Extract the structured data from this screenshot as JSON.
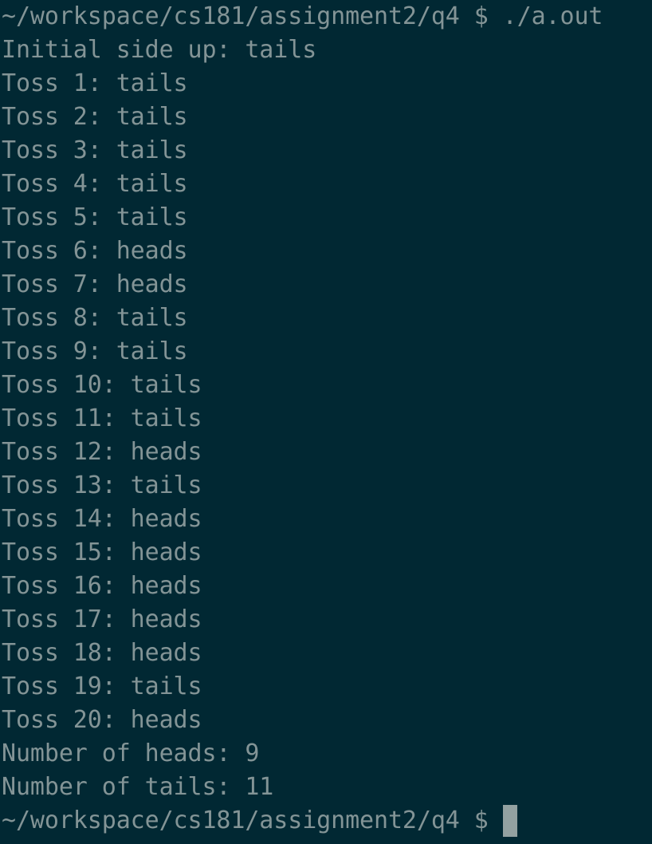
{
  "terminal": {
    "colors": {
      "background": "#012833",
      "foreground": "#839496",
      "cursor": "#93a1a1"
    },
    "command_prompt": "~/workspace/cs181/assignment2/q4 $ ./a.out",
    "output": [
      "Initial side up: tails",
      "Toss 1: tails",
      "Toss 2: tails",
      "Toss 3: tails",
      "Toss 4: tails",
      "Toss 5: tails",
      "Toss 6: heads",
      "Toss 7: heads",
      "Toss 8: tails",
      "Toss 9: tails",
      "Toss 10: tails",
      "Toss 11: tails",
      "Toss 12: heads",
      "Toss 13: tails",
      "Toss 14: heads",
      "Toss 15: heads",
      "Toss 16: heads",
      "Toss 17: heads",
      "Toss 18: heads",
      "Toss 19: tails",
      "Toss 20: heads",
      "Number of heads: 9",
      "Number of tails: 11"
    ],
    "current_prompt": "~/workspace/cs181/assignment2/q4 $"
  }
}
